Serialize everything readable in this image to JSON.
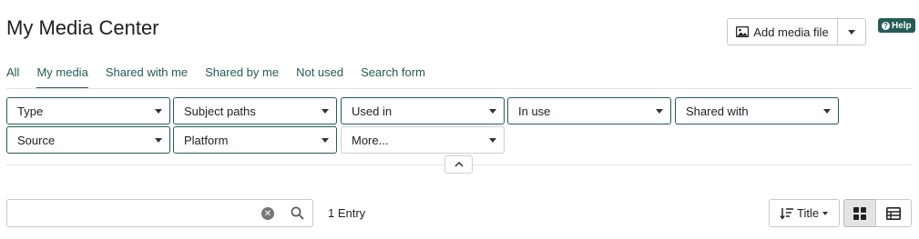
{
  "header": {
    "title": "My Media Center",
    "add_media_label": "Add media file",
    "help_label": "Help"
  },
  "tabs": [
    {
      "label": "All",
      "active": false
    },
    {
      "label": "My media",
      "active": true
    },
    {
      "label": "Shared with me",
      "active": false
    },
    {
      "label": "Shared by me",
      "active": false
    },
    {
      "label": "Not used",
      "active": false
    },
    {
      "label": "Search form",
      "active": false
    }
  ],
  "filters": {
    "type": "Type",
    "subject_paths": "Subject paths",
    "used_in": "Used in",
    "in_use": "In use",
    "shared_with": "Shared with",
    "source": "Source",
    "platform": "Platform",
    "more": "More..."
  },
  "search": {
    "value": "",
    "placeholder": ""
  },
  "results": {
    "count_label": "1 Entry"
  },
  "sort": {
    "label": "Title"
  },
  "view": {
    "active": "grid"
  },
  "colors": {
    "accent": "#245b56",
    "border": "#c8c8c8"
  },
  "icons": [
    "image-icon",
    "chevron-down-icon",
    "help-icon",
    "chevron-up-icon",
    "clear-icon",
    "search-icon",
    "sort-icon",
    "grid-view-icon",
    "table-view-icon"
  ]
}
